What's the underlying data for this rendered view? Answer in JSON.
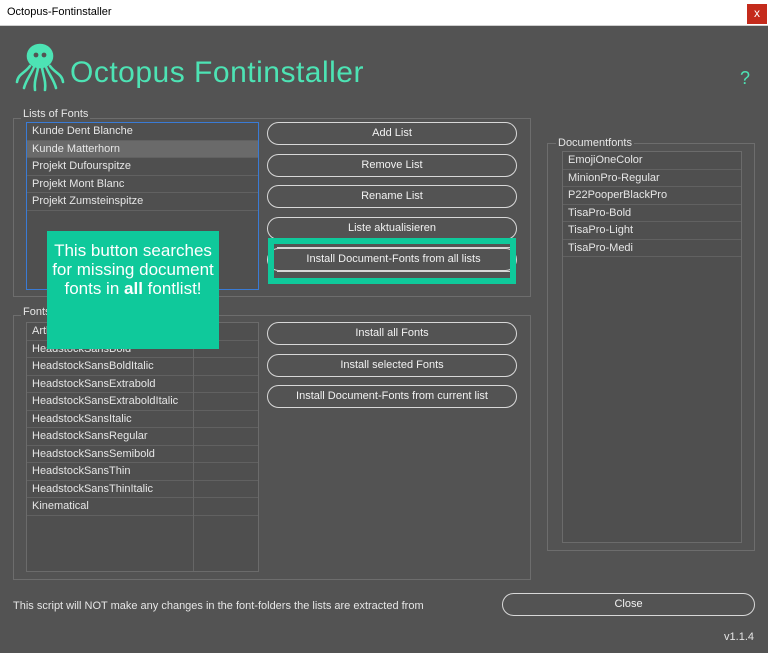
{
  "window": {
    "title": "Octopus-Fontinstaller",
    "close_glyph": "x"
  },
  "header": {
    "app_title": "Octopus Fontinstaller",
    "help_label": "?",
    "accent": "#4de3b4"
  },
  "lists_group": {
    "label": "Lists of Fonts",
    "items": [
      "Kunde Dent Blanche",
      "Kunde Matterhorn",
      "Projekt Dufourspitze",
      "Projekt Mont Blanc",
      "Projekt Zumsteinspitze"
    ],
    "selected_index": 1
  },
  "list_buttons": {
    "add": "Add List",
    "remove": "Remove List",
    "rename": "Rename List",
    "refresh": "Liste aktualisieren",
    "install_all_lists": "Install Document-Fonts from all lists"
  },
  "fonts_group": {
    "label": "Fonts",
    "items": [
      "Arthur",
      "HeadstockSansBold",
      "HeadstockSansBoldItalic",
      "HeadstockSansExtrabold",
      "HeadstockSansExtraboldItalic",
      "HeadstockSansItalic",
      "HeadstockSansRegular",
      "HeadstockSansSemibold",
      "HeadstockSansThin",
      "HeadstockSansThinItalic",
      "Kinematical"
    ]
  },
  "font_buttons": {
    "install_all": "Install all Fonts",
    "install_selected": "Install selected Fonts",
    "install_current": "Install Document-Fonts from current list"
  },
  "document_fonts": {
    "label": "Documentfonts",
    "items": [
      "EmojiOneColor",
      "MinionPro-Regular",
      "P22PooperBlackPro",
      "TisaPro-Bold",
      "TisaPro-Light",
      "TisaPro-Medi"
    ]
  },
  "callout": {
    "line1": "This button searches for missing document fonts in",
    "bold": "all",
    "line2": "fontlist!",
    "color": "#0fc99b"
  },
  "footer": {
    "note": "This script will NOT make any changes in the font-folders the lists are extracted from",
    "close_label": "Close",
    "version": "v1.1.4"
  }
}
